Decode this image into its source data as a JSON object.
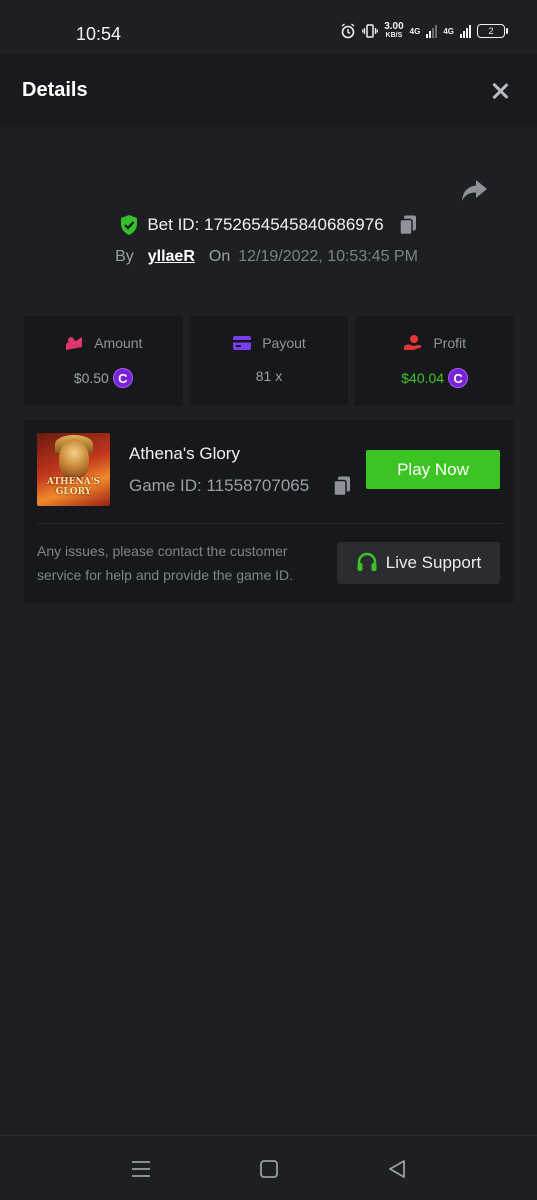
{
  "status_bar": {
    "time": "10:54",
    "speed_value": "3.00",
    "speed_unit": "KB/S",
    "net1": "4G",
    "net2": "4G",
    "battery": "2"
  },
  "header": {
    "title": "Details"
  },
  "bet": {
    "id_label": "Bet ID:",
    "id_value": "1752654545840686976",
    "by_label": "By",
    "username": "yllaeR",
    "on_label": "On",
    "datetime": "12/19/2022, 10:53:45 PM"
  },
  "stats": {
    "amount_label": "Amount",
    "amount_value": "$0.50",
    "payout_label": "Payout",
    "payout_value": "81 x",
    "profit_label": "Profit",
    "profit_value": "$40.04",
    "coin_symbol": "C"
  },
  "game": {
    "thumb_text": "ATHENA'S GLORY",
    "name": "Athena's Glory",
    "id_label": "Game ID: 11558707065",
    "play_label": "Play Now",
    "help_text": "Any issues, please contact the customer service for help and provide the game ID.",
    "support_label": "Live Support"
  },
  "colors": {
    "accent_green": "#3cc423",
    "coin_purple": "#7a22d6",
    "amount_pink": "#e0356f",
    "payout_purple": "#7b3df0",
    "profit_red": "#e53535"
  },
  "icons": [
    "alarm-icon",
    "vibrate-icon",
    "share-icon",
    "shield-check-icon",
    "copy-icon",
    "amount-icon",
    "payout-card-icon",
    "profit-icon",
    "coin-icon",
    "headset-icon",
    "menu-icon",
    "home-icon",
    "back-icon"
  ]
}
